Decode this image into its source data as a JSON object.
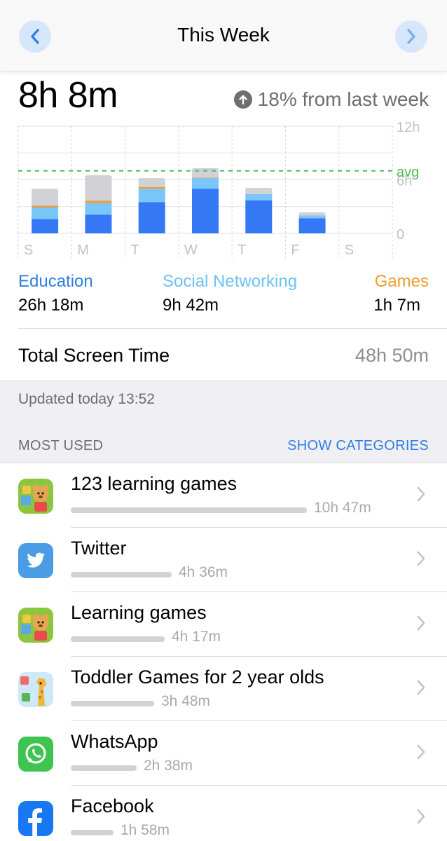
{
  "nav": {
    "title": "This Week",
    "back_icon": "chevron-left-icon",
    "forward_icon": "chevron-right-icon"
  },
  "summary": {
    "total": "8h 8m",
    "delta_text": "18% from last week",
    "delta_icon": "arrow-up-circle-icon"
  },
  "chart_data": {
    "type": "bar",
    "stacked": true,
    "categories": [
      "S",
      "M",
      "T",
      "W",
      "T",
      "F",
      "S"
    ],
    "series": [
      {
        "name": "Education",
        "color": "#3478f6",
        "values": [
          1.6,
          2.1,
          3.5,
          5.0,
          3.7,
          1.7,
          0
        ]
      },
      {
        "name": "Social Networking",
        "color": "#7ac6f9",
        "values": [
          1.3,
          1.3,
          1.5,
          1.2,
          0.7,
          0.3,
          0
        ]
      },
      {
        "name": "Games",
        "color": "#f29a34",
        "values": [
          0.2,
          0.25,
          0.2,
          0.05,
          0,
          0,
          0
        ]
      },
      {
        "name": "Other",
        "color": "#d1d1d6",
        "values": [
          1.9,
          2.85,
          1.0,
          1.05,
          0.7,
          0.35,
          0
        ]
      }
    ],
    "y_ticks": [
      "12h",
      "6h",
      "0"
    ],
    "ylim": [
      0,
      12
    ],
    "avg_label": "avg",
    "avg_value": 7.0,
    "avg_color": "#4cc05a",
    "grid": true
  },
  "categories": [
    {
      "label": "Education",
      "value": "26h 18m",
      "color": "#2f7de1"
    },
    {
      "label": "Social Networking",
      "value": "9h 42m",
      "color": "#6cc1f4"
    },
    {
      "label": "Games",
      "value": "1h 7m",
      "color": "#ef9b2e"
    }
  ],
  "total_screen_time": {
    "label": "Total Screen Time",
    "value": "48h 50m"
  },
  "updated": "Updated today 13:52",
  "most_used": {
    "header": "MOST USED",
    "action": "SHOW CATEGORIES"
  },
  "apps": [
    {
      "name": "123  learning  games",
      "time": "10h 47m",
      "usage": 1.0,
      "icon": "learning-bear-icon"
    },
    {
      "name": "Twitter",
      "time": "4h 36m",
      "usage": 0.427,
      "icon": "twitter-icon"
    },
    {
      "name": "Learning games",
      "time": "4h 17m",
      "usage": 0.397,
      "icon": "learning-bear-icon"
    },
    {
      "name": "Toddler Games for 2 year olds",
      "time": "3h 48m",
      "usage": 0.352,
      "icon": "giraffe-icon"
    },
    {
      "name": "WhatsApp",
      "time": "2h 38m",
      "usage": 0.278,
      "icon": "whatsapp-icon"
    },
    {
      "name": "Facebook",
      "time": "1h 58m",
      "usage": 0.182,
      "icon": "facebook-icon"
    }
  ]
}
